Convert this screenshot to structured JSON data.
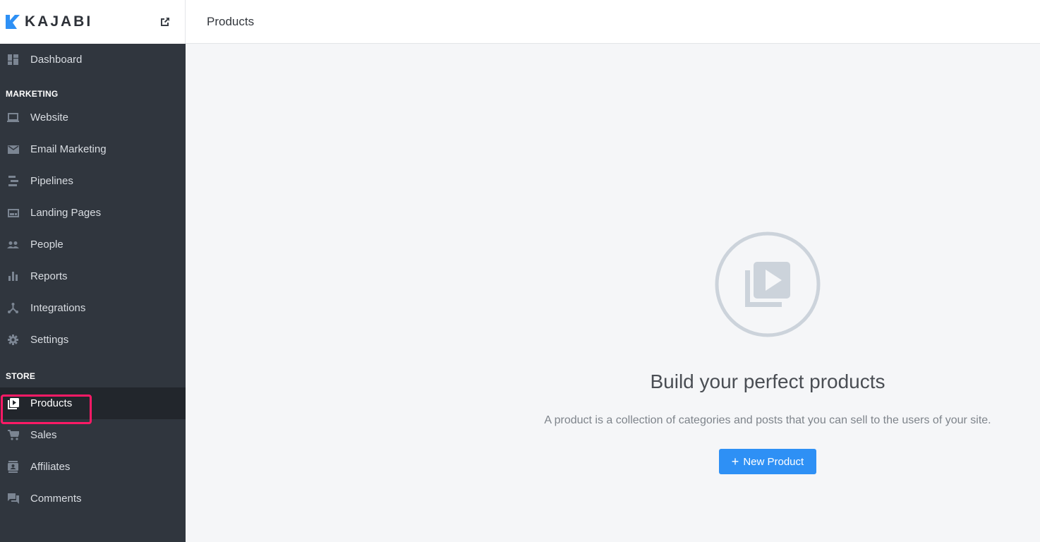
{
  "brand": {
    "name": "KAJABI",
    "accent": "#2e90f5"
  },
  "header": {
    "title": "Products"
  },
  "sidebar": {
    "dashboard": {
      "label": "Dashboard",
      "icon": "dashboard-icon"
    },
    "sections": [
      {
        "title": "MARKETING",
        "items": [
          {
            "label": "Website",
            "icon": "laptop-icon"
          },
          {
            "label": "Email Marketing",
            "icon": "mail-icon"
          },
          {
            "label": "Pipelines",
            "icon": "pipelines-icon"
          },
          {
            "label": "Landing Pages",
            "icon": "landing-page-icon"
          },
          {
            "label": "People",
            "icon": "people-icon"
          },
          {
            "label": "Reports",
            "icon": "bar-chart-icon"
          },
          {
            "label": "Integrations",
            "icon": "integrations-icon"
          },
          {
            "label": "Settings",
            "icon": "gear-icon"
          }
        ]
      },
      {
        "title": "STORE",
        "items": [
          {
            "label": "Products",
            "icon": "video-library-icon",
            "active": true
          },
          {
            "label": "Sales",
            "icon": "cart-icon"
          },
          {
            "label": "Affiliates",
            "icon": "badge-icon"
          },
          {
            "label": "Comments",
            "icon": "comments-icon"
          }
        ]
      }
    ]
  },
  "empty_state": {
    "title": "Build your perfect products",
    "description": "A product is a collection of categories and posts that you can sell to the users of your site.",
    "button_icon": "+",
    "button_label": "New Product"
  }
}
